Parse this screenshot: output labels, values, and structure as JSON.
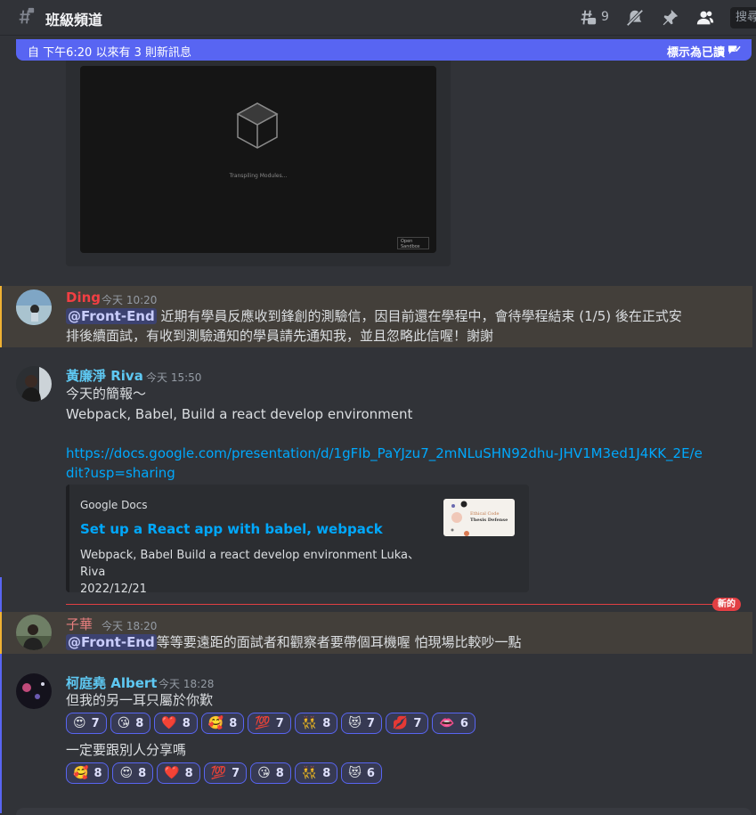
{
  "header": {
    "channel_name": "班級頻道",
    "thread_count": "9",
    "search_placeholder": "搜尋",
    "icons": [
      "hashtag-lock-icon",
      "threads-icon",
      "mute-bell-icon",
      "pin-icon",
      "members-icon"
    ]
  },
  "new_messages_bar": {
    "text": "自 下午6:20 以來有 3 則新訊息",
    "mark_read": "標示為已讀"
  },
  "sandbox_embed": {
    "loading_text": "Transpiling Modules...",
    "open_sandbox": "Open Sandbox"
  },
  "messages": [
    {
      "author": "Ding",
      "author_color": "#f23f43",
      "time": "今天 10:20",
      "mention": "@Front-End",
      "text_line1": "近期有學員反應收到鋒創的測驗信，因目前還在學程中，會待學程結束 (1/5) 後在正式安",
      "text_line2": "排後續面試，有收到測驗通知的學員請先通知我，並且忽略此信喔！謝謝"
    },
    {
      "author": "黃廉淨 Riva",
      "author_color": "#5ec8f2",
      "time": "今天 15:50",
      "line1": "今天的簡報～",
      "line2": "Webpack, Babel, Build a react develop environment",
      "link": "https://docs.google.com/presentation/d/1gFIb_PaYJzu7_2mNLuSHN92dhu-JHV1M3ed1J4KK_2E/edit?usp=sharing",
      "embed": {
        "provider": "Google Docs",
        "title": "Set up a React app with babel, webpack",
        "description_line1": "Webpack, Babel Build a react develop environment Luka、Riva",
        "description_line2": "2022/12/21",
        "thumb_title": "Ethical Code",
        "thumb_subtitle": "Thesis Defense"
      }
    },
    {
      "author": "子華",
      "author_color": "#e67e7e",
      "time": "今天 18:20",
      "mention": "@Front-End",
      "text": "等等要遠距的面試者和觀察者要帶個耳機喔 怕現場比較吵一點"
    },
    {
      "author": "柯庭堯 Albert",
      "author_color": "#5ec8f2",
      "time": "今天 18:28",
      "line1": "但我的另一耳只屬於你歎",
      "reactions1": [
        {
          "emoji": "😍",
          "count": "7"
        },
        {
          "emoji": "😘",
          "count": "8"
        },
        {
          "emoji": "❤️",
          "count": "8"
        },
        {
          "emoji": "🥰",
          "count": "8"
        },
        {
          "emoji": "💯",
          "count": "7"
        },
        {
          "emoji": "👯",
          "count": "8"
        },
        {
          "emoji": "😻",
          "count": "7"
        },
        {
          "emoji": "💋",
          "count": "7"
        },
        {
          "emoji": "👄",
          "count": "6"
        }
      ],
      "line2": "一定要跟別人分享嗎",
      "reactions2": [
        {
          "emoji": "🥰",
          "count": "8"
        },
        {
          "emoji": "😍",
          "count": "8"
        },
        {
          "emoji": "❤️",
          "count": "8"
        },
        {
          "emoji": "💯",
          "count": "7"
        },
        {
          "emoji": "😘",
          "count": "8"
        },
        {
          "emoji": "👯",
          "count": "8"
        },
        {
          "emoji": "😻",
          "count": "6"
        }
      ]
    }
  ],
  "new_divider_label": "新的"
}
